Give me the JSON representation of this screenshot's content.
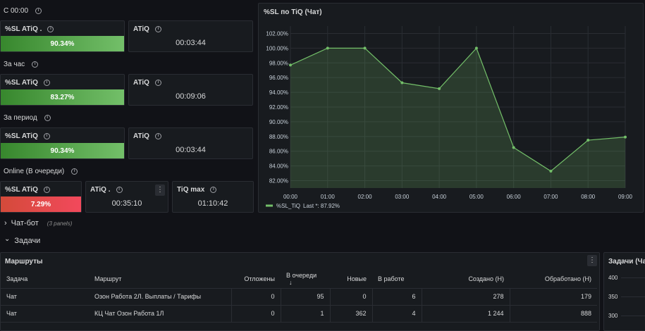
{
  "sections": {
    "s1": "С 00:00",
    "s2": "За час",
    "s3": "За период",
    "s4": "Online (В очереди)"
  },
  "stats": {
    "g1_sl_title": "%SL ATiQ .",
    "g1_sl_value": "90.34%",
    "g1_atiq_title": "ATiQ",
    "g1_atiq_value": "00:03:44",
    "g2_sl_title": "%SL ATiQ",
    "g2_sl_value": "83.27%",
    "g2_atiq_title": "ATiQ",
    "g2_atiq_value": "00:09:06",
    "g3_sl_title": "%SL ATiQ",
    "g3_sl_value": "90.34%",
    "g3_atiq_title": "ATiQ",
    "g3_atiq_value": "00:03:44",
    "g4_sl_title": "%SL ATiQ",
    "g4_sl_value": "7.29%",
    "g4_atiq_title": "ATiQ .",
    "g4_atiq_value": "00:35:10",
    "g4_tiq_title": "TiQ max",
    "g4_tiq_value": "01:10:42",
    "menu_glyph": "⋮"
  },
  "chart_panel": {
    "title": "%SL по TiQ (Чат)",
    "legend_name": "%SL_TiQ",
    "legend_last": "Last *: 87.92%"
  },
  "chart_data": {
    "type": "area",
    "x": [
      "00:00",
      "01:00",
      "02:00",
      "03:00",
      "04:00",
      "05:00",
      "06:00",
      "07:00",
      "08:00",
      "09:00"
    ],
    "series": [
      {
        "name": "%SL_TiQ",
        "values": [
          97.7,
          100.0,
          100.0,
          95.3,
          94.5,
          100.0,
          86.5,
          83.3,
          87.5,
          87.92
        ]
      }
    ],
    "y_ticks": [
      "82.00%",
      "84.00%",
      "86.00%",
      "88.00%",
      "90.00%",
      "92.00%",
      "94.00%",
      "96.00%",
      "98.00%",
      "100.00%",
      "102.00%"
    ],
    "ylim": [
      81,
      103
    ],
    "grid": true,
    "legend": "bottom-left",
    "line_color": "#73bf69"
  },
  "rows": {
    "chatbot_label": "Чат-бот",
    "chatbot_count": "(3 panels)",
    "tasks_label": "Задачи",
    "collapsed_chevron": "›",
    "expanded_chevron": "⌄"
  },
  "routes": {
    "title": "Маршруты",
    "columns": [
      "Задача",
      "Маршрут",
      "Отложены",
      "В очереди",
      "Новые",
      "В работе",
      "Создано (Н)",
      "Обработано (Н)"
    ],
    "sort_arrow": "↓",
    "rows": [
      [
        "Чат",
        "Озон Работа 2Л. Выплаты / Тарифы",
        "0",
        "95",
        "0",
        "6",
        "278",
        "179"
      ],
      [
        "Чат",
        "КЦ Чат Озон Работа 1Л",
        "0",
        "1",
        "362",
        "4",
        "1 244",
        "888"
      ]
    ]
  },
  "right_panel": {
    "title": "Задачи (Чат)",
    "ticks": [
      "400",
      "350",
      "300"
    ]
  }
}
